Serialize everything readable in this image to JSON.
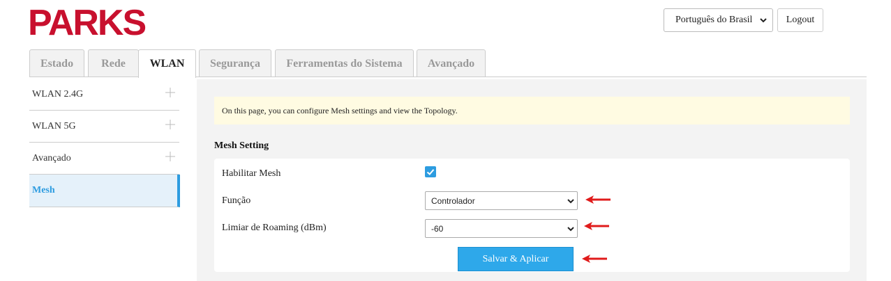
{
  "brand": {
    "logo_text": "PARKS",
    "color": "#c8102e"
  },
  "header": {
    "language_selected": "Português do Brasil",
    "logout_label": "Logout"
  },
  "tabs": [
    {
      "label": "Estado",
      "active": false
    },
    {
      "label": "Rede",
      "active": false
    },
    {
      "label": "WLAN",
      "active": true
    },
    {
      "label": "Segurança",
      "active": false
    },
    {
      "label": "Ferramentas do Sistema",
      "active": false
    },
    {
      "label": "Avançado",
      "active": false
    }
  ],
  "sidebar": {
    "items": [
      {
        "label": "WLAN 2.4G",
        "expandable": true
      },
      {
        "label": "WLAN 5G",
        "expandable": true
      },
      {
        "label": "Avançado",
        "expandable": true
      },
      {
        "label": "Mesh",
        "active": true
      }
    ]
  },
  "main": {
    "notice": "On this page, you can configure Mesh settings and view the Topology.",
    "section_title": "Mesh Setting",
    "enable_mesh": {
      "label": "Habilitar Mesh",
      "checked": true
    },
    "role": {
      "label": "Função",
      "value": "Controlador"
    },
    "roaming": {
      "label": "Limiar de Roaming (dBm)",
      "value": "-60"
    },
    "apply_label": "Salvar & Aplicar"
  },
  "colors": {
    "accent": "#2d9ce0",
    "arrow": "#e01b1b",
    "notice_bg": "#fffbe2"
  }
}
